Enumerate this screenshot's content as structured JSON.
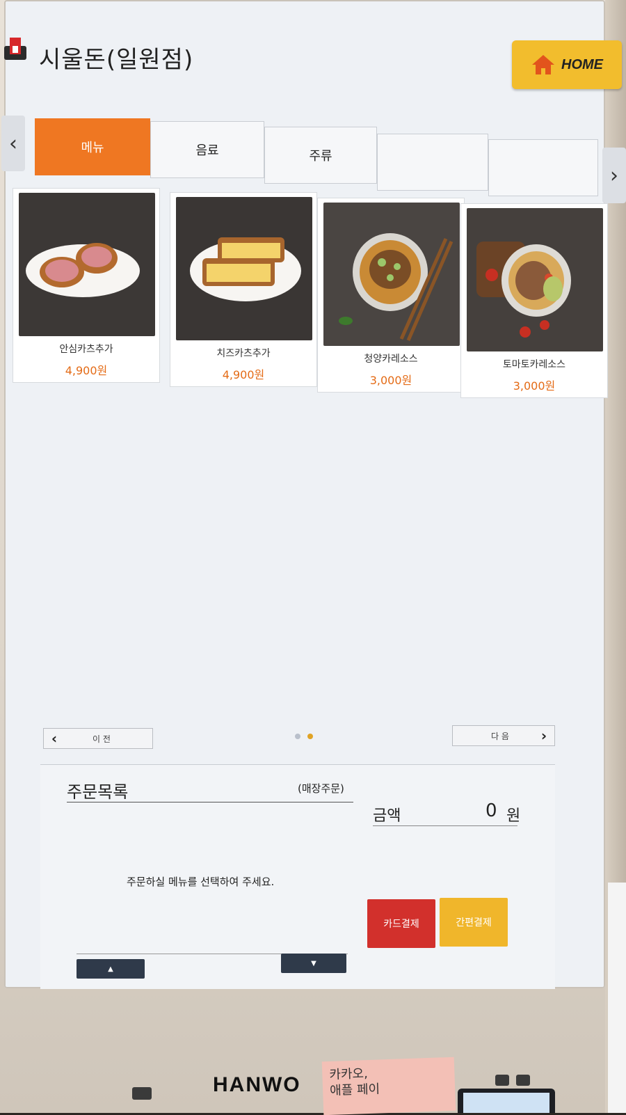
{
  "header": {
    "store_name": "시울돈(일원점)",
    "home_label": "HOME"
  },
  "tabs": [
    {
      "label": "메뉴",
      "active": true
    },
    {
      "label": "음료",
      "active": false
    },
    {
      "label": "주류",
      "active": false
    },
    {
      "label": "",
      "active": false
    },
    {
      "label": "",
      "active": false
    }
  ],
  "menu_items": [
    {
      "name": "안심카츠추가",
      "price": "4,900원"
    },
    {
      "name": "치즈카츠추가",
      "price": "4,900원"
    },
    {
      "name": "청양카레소스",
      "price": "3,000원"
    },
    {
      "name": "토마토카레소스",
      "price": "3,000원"
    }
  ],
  "pager": {
    "prev_label": "이 전",
    "next_label": "다 음",
    "current_page": 2,
    "total_pages": 2
  },
  "order": {
    "title": "주문목록",
    "type_label": "(매장주문)",
    "amount_label": "금액",
    "amount_value": "0",
    "amount_unit": "원",
    "empty_message": "주문하실 메뉴를 선택하여 주세요.",
    "card_pay_label": "카드결제",
    "easy_pay_label": "간편결제"
  },
  "kiosk": {
    "brand": "HANWO",
    "sticky_note_line1": "카카오,",
    "sticky_note_line2": "애플 페이"
  },
  "colors": {
    "accent_orange": "#ef7722",
    "price_orange": "#e46b16",
    "home_yellow": "#f2bd2d",
    "card_pay_red": "#d2302c",
    "easy_pay_yellow": "#f0b62b"
  }
}
